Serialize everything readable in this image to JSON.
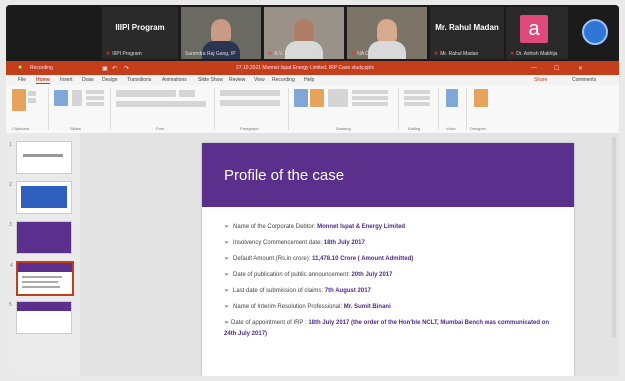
{
  "participants": [
    {
      "title": "IIIPI Program",
      "name": "IIIPI Program"
    },
    {
      "name": "Surendra Raj Gang, IP"
    },
    {
      "name": "A.V. Nagarajan"
    },
    {
      "name": "NA Carol Doan, IP"
    },
    {
      "title": "Mr. Rahul Madan",
      "name": "Mr. Rahul Madan"
    },
    {
      "initial": "a",
      "name": "Dr. Ashish Makhija"
    }
  ],
  "meeting": {
    "recording_label": "Recording"
  },
  "ppt": {
    "window_title": "27.10.2021 Monnet Ispat Energy Limited, IRP Case study.pptx",
    "tabs": [
      "File",
      "Home",
      "Insert",
      "Draw",
      "Design",
      "Transitions",
      "Animations",
      "Slide Show",
      "Review",
      "View",
      "Recording",
      "Help"
    ],
    "active_tab": "Home",
    "share_label": "Share",
    "comments_label": "Comments",
    "ribbon_groups": [
      "Clipboard",
      "Slides",
      "Font",
      "Paragraph",
      "Drawing",
      "Editing",
      "Voice",
      "Designer"
    ]
  },
  "thumbnails": [
    {
      "num": "1"
    },
    {
      "num": "2"
    },
    {
      "num": "3"
    },
    {
      "num": "4"
    },
    {
      "num": "5"
    }
  ],
  "slide": {
    "title": "Profile of the case",
    "bullets": [
      {
        "label": "Name of the Corporate Debtor: ",
        "value": "Monnet Ispat & Energy Limited"
      },
      {
        "label": "Insolvency Commencement date: ",
        "value": "18th July 2017"
      },
      {
        "label": "Default Amount (Rs.in crore): ",
        "value": "11,478.10 Crore ( Amount Admitted)"
      },
      {
        "label": "Date of publication of public announcement: ",
        "value": "20th July 2017"
      },
      {
        "label": "Last date of submission of claims: ",
        "value": "7th August 2017"
      },
      {
        "label": "Name of Interim Resolution Professional: ",
        "value": "Mr. Sumit Binani"
      }
    ],
    "last_bullet_label": "Date of appointment of IRP : ",
    "last_bullet_value": "18th July 2017 (the order of the Hon'ble     NCLT, Mumbai Bench was communicated on 24th July 2017)"
  },
  "colors": {
    "ppt_accent": "#c43e1c",
    "slide_header": "#5b2f8c"
  }
}
